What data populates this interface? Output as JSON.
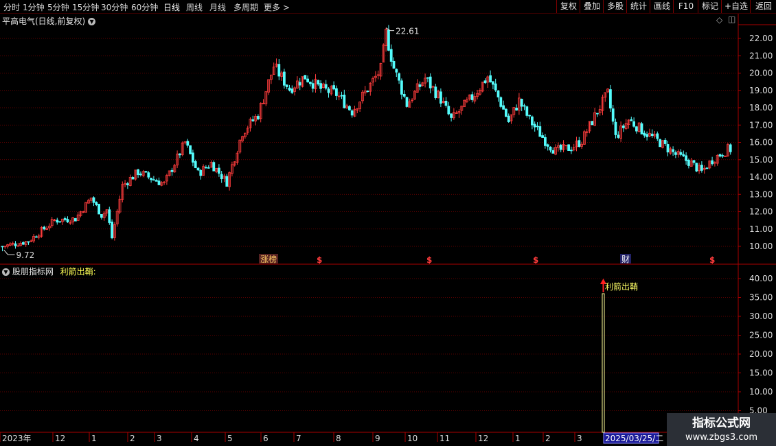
{
  "periods": [
    "分时",
    "1分钟",
    "5分钟",
    "15分钟",
    "30分钟",
    "60分钟",
    "日线",
    "周线",
    "月线",
    "多周期",
    "更多 >"
  ],
  "active_period": "日线",
  "tools": [
    "复权",
    "叠加",
    "多股",
    "统计",
    "画线",
    "F10",
    "标记",
    "+自选",
    "返回"
  ],
  "main_title": "平高电气(日线,前复权)",
  "indicator_source": "股朋指标网",
  "indicator_name": "利箭出鞘:",
  "signal_label": "利箭出鞘",
  "high_label": "22.61",
  "low_label": "9.72",
  "date_cursor": "2025/03/25/二",
  "watermark_title": "指标公式网",
  "watermark_url": "www.zbgs3.com",
  "event_markers": [
    {
      "label": "涨榜",
      "type": "list"
    },
    {
      "label": "$",
      "type": "dollar"
    },
    {
      "label": "$",
      "type": "dollar"
    },
    {
      "label": "$",
      "type": "dollar"
    },
    {
      "label": "财",
      "type": "fin"
    },
    {
      "label": "$",
      "type": "dollar"
    }
  ],
  "colors": {
    "up": "#ff3c3c",
    "down": "#54fcfc",
    "axis": "#aa0000",
    "grid": "#7a0000",
    "signal": "#ffff99",
    "arrow": "#ff2020"
  },
  "chart_data": [
    {
      "type": "candlestick",
      "title": "平高电气(日线,前复权)",
      "y_ticks": [
        "22.00",
        "21.00",
        "20.00",
        "19.00",
        "18.00",
        "17.00",
        "16.00",
        "15.00",
        "14.00",
        "13.00",
        "12.00",
        "11.00",
        "10.00"
      ],
      "ylim": [
        9.5,
        22.8
      ],
      "x_ticks": [
        "2023年",
        "12",
        "1",
        "2",
        "3",
        "4",
        "5",
        "6",
        "7",
        "8",
        "9",
        "10",
        "11",
        "12",
        "1",
        "2",
        "3"
      ],
      "highest": 22.61,
      "lowest": 9.72,
      "close_path": [
        [
          0,
          10.0
        ],
        [
          10,
          10.3
        ],
        [
          20,
          11.5
        ],
        [
          28,
          11.6
        ],
        [
          34,
          12.8
        ],
        [
          38,
          11.8
        ],
        [
          40,
          12.1
        ],
        [
          42,
          10.5
        ],
        [
          46,
          13.5
        ],
        [
          52,
          14.3
        ],
        [
          56,
          14.0
        ],
        [
          62,
          13.6
        ],
        [
          70,
          16.0
        ],
        [
          75,
          14.2
        ],
        [
          80,
          14.8
        ],
        [
          86,
          13.7
        ],
        [
          92,
          16.6
        ],
        [
          98,
          17.6
        ],
        [
          104,
          20.4
        ],
        [
          110,
          19.1
        ],
        [
          116,
          19.8
        ],
        [
          122,
          19.1
        ],
        [
          128,
          18.8
        ],
        [
          134,
          17.8
        ],
        [
          140,
          19.1
        ],
        [
          145,
          20.2
        ],
        [
          147,
          22.3
        ],
        [
          150,
          20.3
        ],
        [
          155,
          18.2
        ],
        [
          162,
          19.7
        ],
        [
          168,
          18.5
        ],
        [
          172,
          17.3
        ],
        [
          180,
          18.6
        ],
        [
          186,
          19.8
        ],
        [
          190,
          18.6
        ],
        [
          194,
          17.2
        ],
        [
          198,
          18.4
        ],
        [
          202,
          17.3
        ],
        [
          208,
          16.1
        ],
        [
          212,
          15.5
        ],
        [
          218,
          15.7
        ],
        [
          222,
          16.1
        ],
        [
          228,
          17.8
        ],
        [
          232,
          18.8
        ],
        [
          235,
          16.3
        ],
        [
          240,
          17.3
        ],
        [
          246,
          16.6
        ],
        [
          252,
          16.0
        ],
        [
          258,
          15.3
        ],
        [
          264,
          14.8
        ],
        [
          268,
          14.3
        ],
        [
          272,
          15.0
        ],
        [
          278,
          15.6
        ]
      ]
    },
    {
      "type": "bar",
      "title": "利箭出鞘",
      "y_ticks": [
        "40.00",
        "35.00",
        "30.00",
        "25.00",
        "20.00",
        "15.00",
        "10.00",
        "5.00"
      ],
      "ylim": [
        0,
        42.5
      ],
      "signal_date": "2025/03/25/二",
      "signal_value": 36
    }
  ]
}
